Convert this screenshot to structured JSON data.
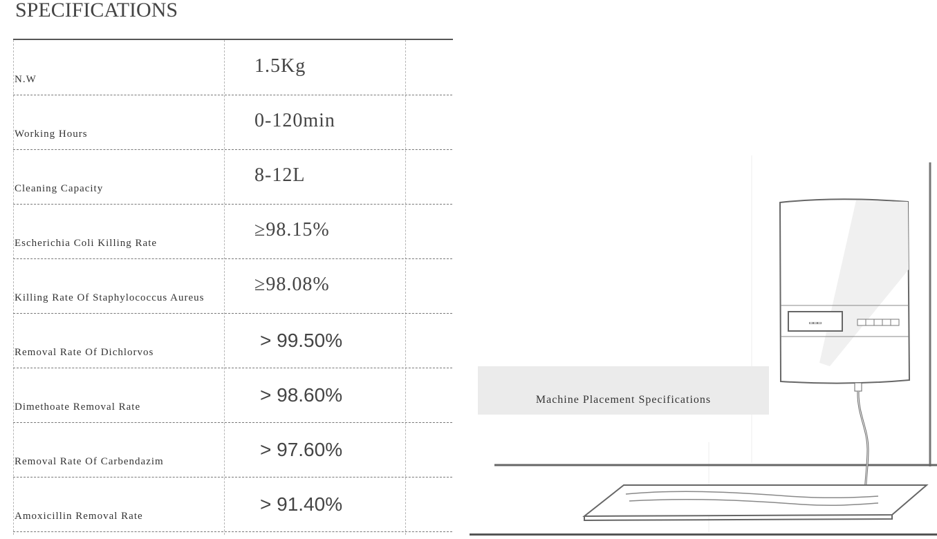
{
  "title": "SPECIFICATIONS",
  "specs": [
    {
      "label": "N.W",
      "value": "1.5Kg"
    },
    {
      "label": "Working  Hours",
      "value": "0-120min"
    },
    {
      "label": "Cleaning  Capacity",
      "value": "8-12L"
    },
    {
      "label": "Escherichia  Coli  Killing  Rate",
      "value": "≥98.15%"
    },
    {
      "label": "Killing  Rate  Of  Staphylococcus  Aureus",
      "value": "≥98.08%"
    },
    {
      "label": "Removal  Rate  Of  Dichlorvos",
      "value": "> 99.50%"
    },
    {
      "label": "Dimethoate  Removal  Rate",
      "value": "> 98.60%"
    },
    {
      "label": "Removal  Rate  Of  Carbendazim",
      "value": "> 97.60%"
    },
    {
      "label": "Amoxicillin  Removal  Rate",
      "value": "> 91.40%"
    }
  ],
  "caption": "Machine  Placement  Specifications",
  "colors": {
    "caption_bg": "#ebebeb",
    "rule": "#555555"
  }
}
